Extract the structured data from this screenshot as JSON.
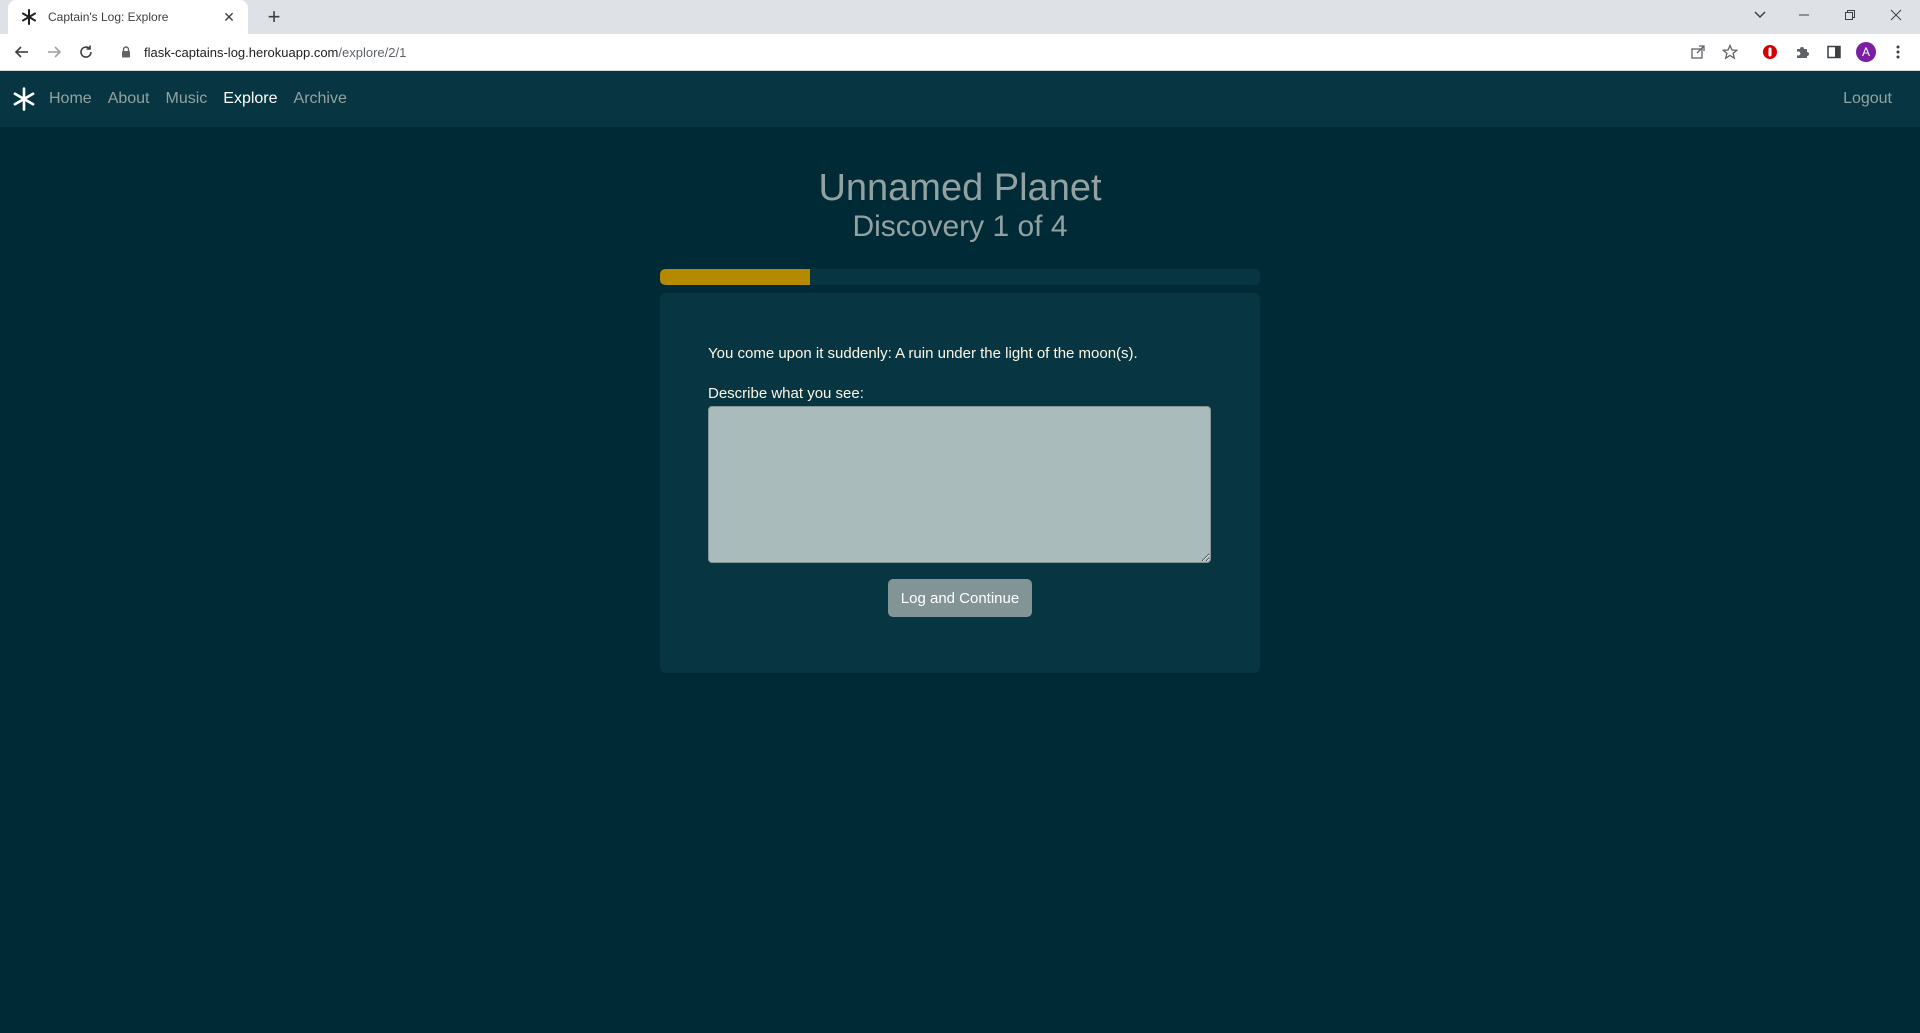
{
  "browser": {
    "tab_title": "Captain's Log: Explore",
    "url_host": "flask-captains-log.herokuapp.com",
    "url_path": "/explore/2/1",
    "profile_initial": "A"
  },
  "nav": {
    "links": [
      "Home",
      "About",
      "Music",
      "Explore",
      "Archive"
    ],
    "active": "Explore",
    "logout": "Logout"
  },
  "page": {
    "planet_name": "Unnamed Planet",
    "discovery_text": "Discovery 1 of 4",
    "progress_fraction": 0.25,
    "prompt": "You come upon it suddenly: A ruin under the light of the moon(s).",
    "describe_label": "Describe what you see:",
    "describe_value": "",
    "submit_label": "Log and Continue"
  },
  "colors": {
    "background": "#002b36",
    "nav_bg": "#073642",
    "progress_fill": "#b58900",
    "input_bg": "#a9bbbb",
    "button_bg": "#839496"
  }
}
